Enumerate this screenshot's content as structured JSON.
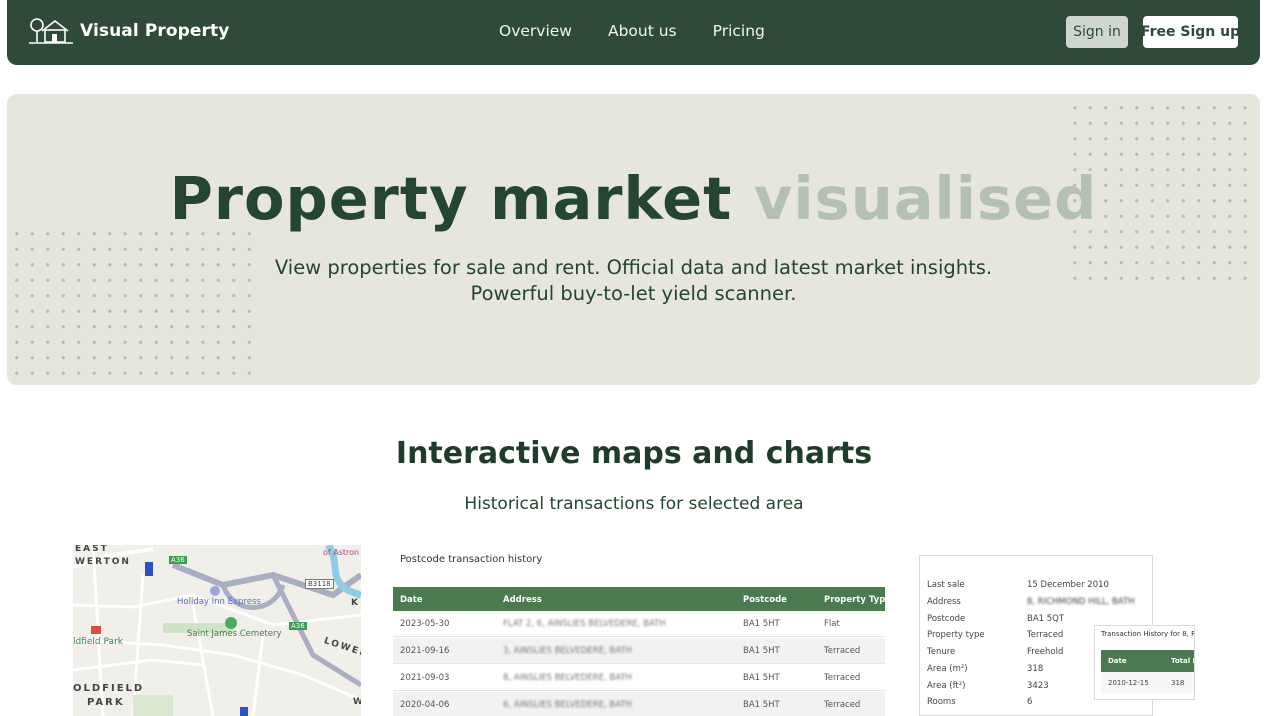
{
  "nav": {
    "brand": "Visual Property",
    "links": [
      "Overview",
      "About us",
      "Pricing"
    ],
    "signin": "Sign in",
    "signup": "Free Sign up"
  },
  "hero": {
    "title_main": "Property market",
    "title_faded": "visualised",
    "subtitle_line1": "View properties for sale and rent. Official data and latest market insights.",
    "subtitle_line2": "Powerful buy-to-let yield scanner."
  },
  "features": {
    "title": "Interactive maps and charts",
    "subtitle": "Historical transactions for selected area"
  },
  "map": {
    "labels": [
      "EAST",
      "WERTON",
      "A36",
      "of Astron",
      "B3118",
      "Holiday Inn Express",
      "K",
      "Saint James Cemetery",
      "A36",
      "LOWER",
      "ldfield Park",
      "OLDFIELD",
      "PARK",
      "W"
    ]
  },
  "transactions": {
    "title": "Postcode transaction history",
    "columns": [
      "Date",
      "Address",
      "Postcode",
      "Property Type"
    ],
    "rows": [
      [
        "2023-05-30",
        "FLAT 2, 6, AINSLIES BELVEDERE, BATH",
        "BA1 5HT",
        "Flat"
      ],
      [
        "2021-09-16",
        "3, AINSLIES BELVEDERE, BATH",
        "BA1 5HT",
        "Terraced"
      ],
      [
        "2021-09-03",
        "8, AINSLIES BELVEDERE, BATH",
        "BA1 5HT",
        "Terraced"
      ],
      [
        "2020-04-06",
        "6, AINSLIES BELVEDERE, BATH",
        "BA1 5HT",
        "Terraced"
      ]
    ]
  },
  "details": {
    "rows": [
      [
        "Last sale",
        "15 December 2010"
      ],
      [
        "Address",
        "8, RICHMOND HILL, BATH"
      ],
      [
        "Postcode",
        "BA1 5QT"
      ],
      [
        "Property type",
        "Terraced"
      ],
      [
        "Tenure",
        "Freehold"
      ],
      [
        "Area (m²)",
        "318"
      ],
      [
        "Area (ft²)",
        "3423"
      ],
      [
        "Rooms",
        "6"
      ]
    ],
    "popup_title": "Transaction History for 8, R",
    "popup_columns": [
      "Date",
      "Total F"
    ],
    "popup_row": [
      "2010-12-15",
      "318"
    ]
  }
}
